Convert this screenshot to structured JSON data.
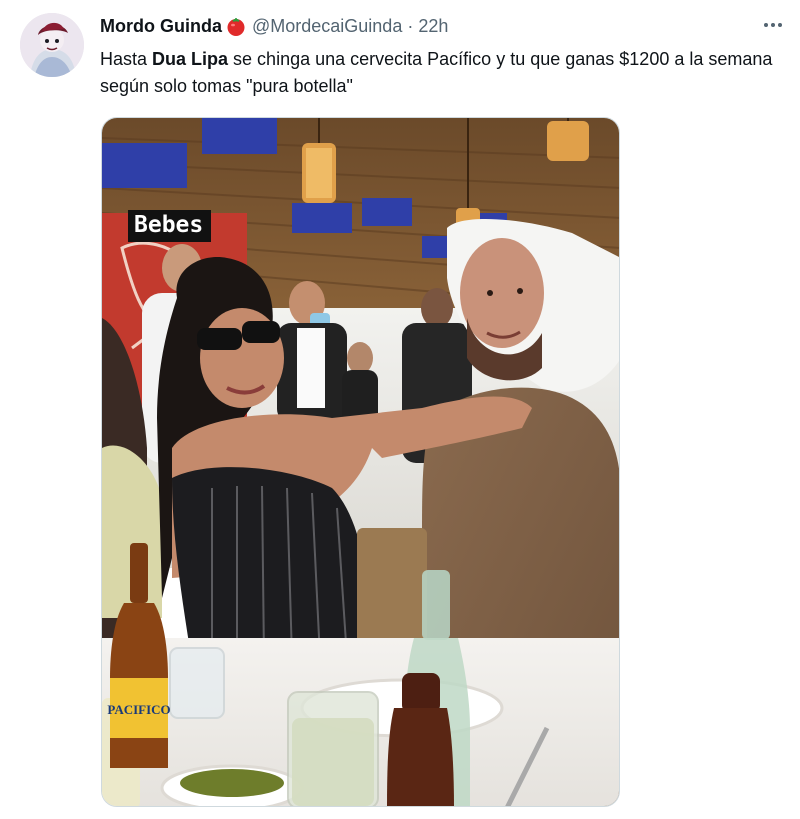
{
  "tweet": {
    "display_name": "Mordo Guinda",
    "handle": "@MordecaiGuinda",
    "separator": "·",
    "time": "22h",
    "text_part1": "Hasta ",
    "text_bold": "Dua Lipa",
    "text_part2": " se chinga una cervecita Pacífico y tu que ganas $1200 a la semana según solo tomas \"pura botella\"",
    "name_emoji": "tomato-emoji-icon"
  },
  "media": {
    "sticker_text": "Bebes",
    "bottle_label": "PACIFICO"
  },
  "colors": {
    "text_primary": "#0f1419",
    "text_secondary": "#536471",
    "border": "#cfd9de"
  }
}
